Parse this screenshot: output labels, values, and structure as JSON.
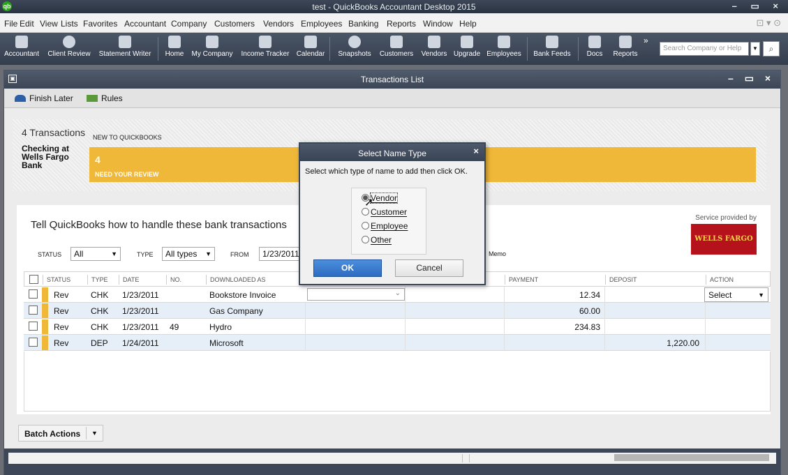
{
  "window": {
    "title": "test  - QuickBooks Accountant Desktop 2015",
    "logo": "qb",
    "buttons": "– ▭ ×"
  },
  "menu": [
    {
      "label": "File"
    },
    {
      "label": "Edit"
    },
    {
      "label": "View"
    },
    {
      "label": "Lists"
    },
    {
      "label": "Favorites"
    },
    {
      "label": "Accountant"
    },
    {
      "label": "Company"
    },
    {
      "label": "Customers"
    },
    {
      "label": "Vendors"
    },
    {
      "label": "Employees"
    },
    {
      "label": "Banking"
    },
    {
      "label": "Reports"
    },
    {
      "label": "Window"
    },
    {
      "label": "Help"
    }
  ],
  "menu_right": "⊡ ▾  ⊙",
  "toolbar": {
    "items": [
      {
        "label": "Accountant",
        "icon": "accountant-icon"
      },
      {
        "label": "Client Review",
        "icon": "client-review-icon"
      },
      {
        "label": "Statement Writer",
        "icon": "statement-writer-icon"
      },
      {
        "label": "Home",
        "icon": "home-icon"
      },
      {
        "label": "My Company",
        "icon": "my-company-icon"
      },
      {
        "label": "Income Tracker",
        "icon": "income-tracker-icon"
      },
      {
        "label": "Calendar",
        "icon": "calendar-icon"
      },
      {
        "label": "Snapshots",
        "icon": "snapshots-icon"
      },
      {
        "label": "Customers",
        "icon": "customers-icon"
      },
      {
        "label": "Vendors",
        "icon": "vendors-icon"
      },
      {
        "label": "Upgrade",
        "icon": "upgrade-icon"
      },
      {
        "label": "Employees",
        "icon": "employees-icon"
      },
      {
        "label": "Bank Feeds",
        "icon": "bank-feeds-icon"
      },
      {
        "label": "Docs",
        "icon": "docs-icon"
      },
      {
        "label": "Reports",
        "icon": "reports-icon"
      }
    ],
    "more": "»",
    "search_placeholder": "Search Company or Help"
  },
  "transactions_window": {
    "title": "Transactions List",
    "sys_icon": "▣",
    "buttons": "– ▭ ×",
    "finish_later": "Finish Later",
    "rules": "Rules"
  },
  "summary": {
    "count_text": "4 Transactions",
    "account": "Checking at Wells Fargo Bank",
    "new_label": "NEW TO QUICKBOOKS",
    "review_count": "4",
    "review_label": "NEED YOUR REVIEW"
  },
  "main": {
    "heading": "Tell QuickBooks how to handle these bank transactions",
    "service_text": "Service provided by",
    "bank_logo": "WELLS FARGO",
    "filters": {
      "status_label": "STATUS",
      "status_value": "All",
      "type_label": "TYPE",
      "type_value": "All types",
      "from_label": "FROM",
      "from_value": "1/23/2011",
      "memo_label": "Memo"
    },
    "columns": [
      "STATUS",
      "TYPE",
      "DATE",
      "NO.",
      "DOWNLOADED AS",
      "PAYMENT",
      "DEPOSIT",
      "ACTION"
    ],
    "rows": [
      {
        "status": "Rev",
        "type": "CHK",
        "date": "1/23/2011",
        "no": "",
        "downloaded_as": "Bookstore Invoice",
        "payment": "12.34",
        "deposit": "",
        "action": "Select"
      },
      {
        "status": "Rev",
        "type": "CHK",
        "date": "1/23/2011",
        "no": "",
        "downloaded_as": "Gas Company",
        "payment": "60.00",
        "deposit": "",
        "action": ""
      },
      {
        "status": "Rev",
        "type": "CHK",
        "date": "1/23/2011",
        "no": "49",
        "downloaded_as": "Hydro",
        "payment": "234.83",
        "deposit": "",
        "action": ""
      },
      {
        "status": "Rev",
        "type": "DEP",
        "date": "1/24/2011",
        "no": "",
        "downloaded_as": "Microsoft",
        "payment": "",
        "deposit": "1,220.00",
        "action": ""
      }
    ],
    "batch_actions": "Batch Actions"
  },
  "dialog": {
    "title": "Select Name Type",
    "close": "×",
    "message": "Select which type of name to add then click OK.",
    "options": [
      {
        "label": "Vendor",
        "checked": true
      },
      {
        "label": "Customer",
        "checked": false
      },
      {
        "label": "Employee",
        "checked": false
      },
      {
        "label": "Other",
        "checked": false
      }
    ],
    "ok": "OK",
    "cancel": "Cancel"
  }
}
